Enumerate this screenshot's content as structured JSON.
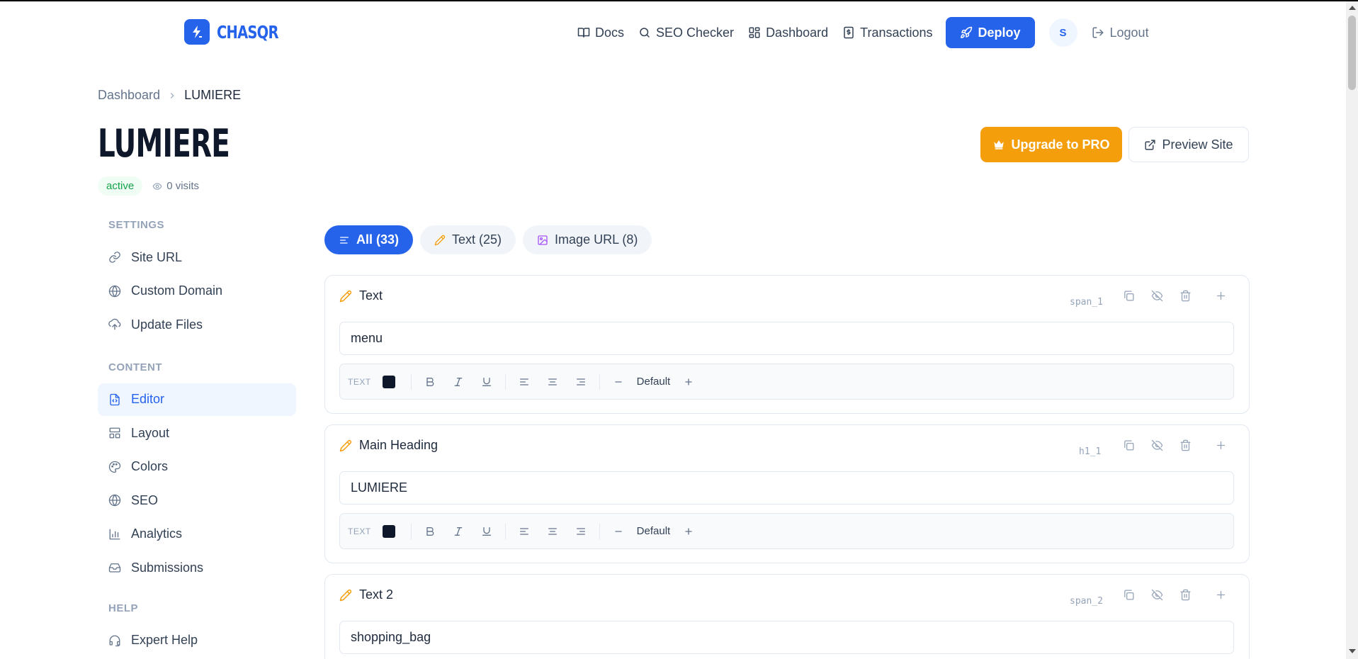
{
  "brand": {
    "name": "CHASQR"
  },
  "nav": {
    "links": [
      {
        "label": "Docs",
        "icon": "book-icon"
      },
      {
        "label": "SEO Checker",
        "icon": "search-icon"
      },
      {
        "label": "Dashboard",
        "icon": "grid-icon"
      },
      {
        "label": "Transactions",
        "icon": "receipt-icon"
      }
    ],
    "deploy_label": "Deploy",
    "avatar_initial": "S",
    "logout_label": "Logout"
  },
  "breadcrumb": {
    "parent": "Dashboard",
    "current": "LUMIERE"
  },
  "page": {
    "title": "LUMIERE",
    "status": "active",
    "visits": "0 visits",
    "upgrade_label": "Upgrade to PRO",
    "preview_label": "Preview Site"
  },
  "sidebar": {
    "sections": [
      {
        "title": "SETTINGS",
        "items": [
          {
            "label": "Site URL",
            "icon": "link-icon"
          },
          {
            "label": "Custom Domain",
            "icon": "globe-icon"
          },
          {
            "label": "Update Files",
            "icon": "cloud-upload-icon"
          }
        ]
      },
      {
        "title": "CONTENT",
        "items": [
          {
            "label": "Editor",
            "icon": "file-code-icon",
            "active": true
          },
          {
            "label": "Layout",
            "icon": "layout-icon"
          },
          {
            "label": "Colors",
            "icon": "palette-icon"
          },
          {
            "label": "SEO",
            "icon": "globe-icon"
          },
          {
            "label": "Analytics",
            "icon": "bar-chart-icon"
          },
          {
            "label": "Submissions",
            "icon": "inbox-icon"
          }
        ]
      },
      {
        "title": "HELP",
        "items": [
          {
            "label": "Expert Help",
            "icon": "headset-icon"
          }
        ]
      }
    ]
  },
  "tabs": [
    {
      "label": "All (33)",
      "icon": "list-icon",
      "active": true
    },
    {
      "label": "Text (25)",
      "icon": "pencil-icon"
    },
    {
      "label": "Image URL (8)",
      "icon": "image-icon"
    }
  ],
  "toolbar": {
    "type_label": "TEXT",
    "size_label": "Default",
    "text_color": "#0f172a"
  },
  "cards": [
    {
      "title": "Text",
      "id": "span_1",
      "value": "menu"
    },
    {
      "title": "Main Heading",
      "id": "h1_1",
      "value": "LUMIERE"
    },
    {
      "title": "Text 2",
      "id": "span_2",
      "value": "shopping_bag"
    }
  ],
  "colors": {
    "accent": "#2563eb",
    "upgrade": "#f59e0b",
    "active_badge": "#16a34a"
  }
}
